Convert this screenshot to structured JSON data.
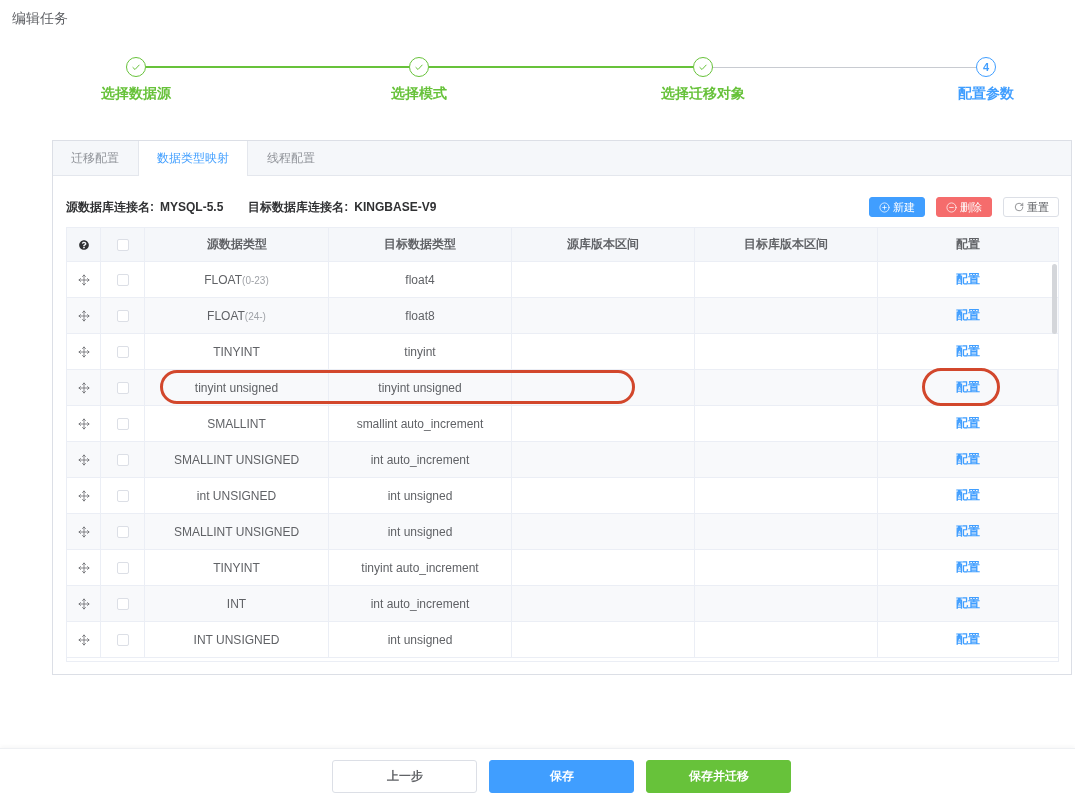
{
  "page_title": "编辑任务",
  "steps": [
    {
      "label": "选择数据源",
      "kind": "done"
    },
    {
      "label": "选择模式",
      "kind": "done"
    },
    {
      "label": "选择迁移对象",
      "kind": "done"
    },
    {
      "label": "配置参数",
      "kind": "active",
      "number": "4"
    }
  ],
  "tabs": [
    {
      "label": "迁移配置",
      "selected": false
    },
    {
      "label": "数据类型映射",
      "selected": true
    },
    {
      "label": "线程配置",
      "selected": false
    }
  ],
  "connections": [
    {
      "label": "源数据库连接名:",
      "value": "MYSQL-5.5"
    },
    {
      "label": "目标数据库连接名:",
      "value": "KINGBASE-V9"
    }
  ],
  "toolbar_buttons": [
    {
      "label": "新建",
      "kind": "add"
    },
    {
      "label": "删除",
      "kind": "delete"
    },
    {
      "label": "重置",
      "kind": "reset"
    }
  ],
  "table": {
    "select_all": {
      "checked": false
    },
    "columns": [
      "源数据类型",
      "目标数据类型",
      "源库版本区间",
      "目标库版本区间",
      "配置"
    ],
    "rows": [
      {
        "source_type": "FLOAT",
        "source_suffix": "(0-23)",
        "target_type": "float4",
        "action": "配置",
        "checked": false,
        "circled": false,
        "action_circled": false
      },
      {
        "source_type": "FLOAT",
        "source_suffix": "(24-)",
        "target_type": "float8",
        "action": "配置",
        "checked": false,
        "circled": false,
        "action_circled": false
      },
      {
        "source_type": "TINYINT",
        "target_type": "tinyint",
        "action": "配置",
        "checked": false,
        "circled": false,
        "action_circled": false
      },
      {
        "source_type": "tinyint unsigned",
        "target_type": "tinyint unsigned",
        "action": "配置",
        "checked": false,
        "circled": true,
        "action_circled": true
      },
      {
        "source_type": "SMALLINT",
        "target_type": "smallint auto_increment",
        "action": "配置",
        "checked": false,
        "circled": false,
        "action_circled": false
      },
      {
        "source_type": "SMALLINT UNSIGNED",
        "target_type": "int auto_increment",
        "action": "配置",
        "checked": false,
        "circled": false,
        "action_circled": false
      },
      {
        "source_type": "int UNSIGNED",
        "target_type": "int unsigned",
        "action": "配置",
        "checked": false,
        "circled": false,
        "action_circled": false
      },
      {
        "source_type": "SMALLINT UNSIGNED",
        "target_type": "int unsigned",
        "action": "配置",
        "checked": false,
        "circled": false,
        "action_circled": false
      },
      {
        "source_type": "TINYINT",
        "target_type": "tinyint auto_increment",
        "action": "配置",
        "checked": false,
        "circled": false,
        "action_circled": false
      },
      {
        "source_type": "INT",
        "target_type": "int auto_increment",
        "action": "配置",
        "checked": false,
        "circled": false,
        "action_circled": false
      },
      {
        "source_type": "INT UNSIGNED",
        "target_type": "int unsigned",
        "action": "配置",
        "checked": false,
        "circled": false,
        "action_circled": false
      }
    ]
  },
  "footer_buttons": [
    {
      "label": "上一步",
      "kind": "default"
    },
    {
      "label": "保存",
      "kind": "primary"
    },
    {
      "label": "保存并迁移",
      "kind": "success"
    }
  ]
}
